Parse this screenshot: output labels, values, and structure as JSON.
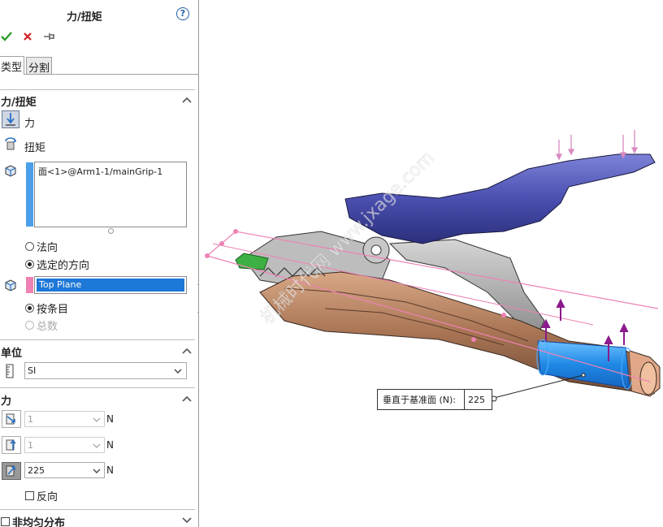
{
  "panel": {
    "title": "力/扭矩",
    "help_label": "?",
    "tabs": [
      "类型",
      "分割"
    ],
    "force_section": {
      "header": "力/扭矩",
      "force_label": "力",
      "torque_label": "扭矩",
      "selection_item": "面<1>@Arm1-1/mainGrip-1",
      "normal_label": "法向",
      "selected_dir_label": "选定的方向",
      "direction_ref": "Top Plane",
      "per_item_label": "按条目",
      "total_label": "总数",
      "selected_direction": "选定的方向",
      "distribution": "按条目"
    },
    "units_section": {
      "header": "单位",
      "units_value": "SI"
    },
    "force_values": {
      "header": "力",
      "fields": [
        {
          "value": "1",
          "unit": "N",
          "enabled": false
        },
        {
          "value": "1",
          "unit": "N",
          "enabled": false
        },
        {
          "value": "225",
          "unit": "N",
          "enabled": true
        }
      ],
      "reverse_label": "反向"
    },
    "nonuniform_label": "非均匀分布"
  },
  "callout": {
    "label": "垂直于基准面 (N):",
    "value": "225"
  },
  "watermark": "机械时代网 www.jxage.com",
  "colors": {
    "accent_blue": "#4a9fe8",
    "pink": "#ee82b4",
    "selection_blue": "#1e78d7",
    "arrow_purple": "#8b1a8b",
    "handle_blue": "#4a4fb0",
    "brown": "#a87454",
    "check_green": "#2e9a2e",
    "cross_red": "#d42020"
  }
}
